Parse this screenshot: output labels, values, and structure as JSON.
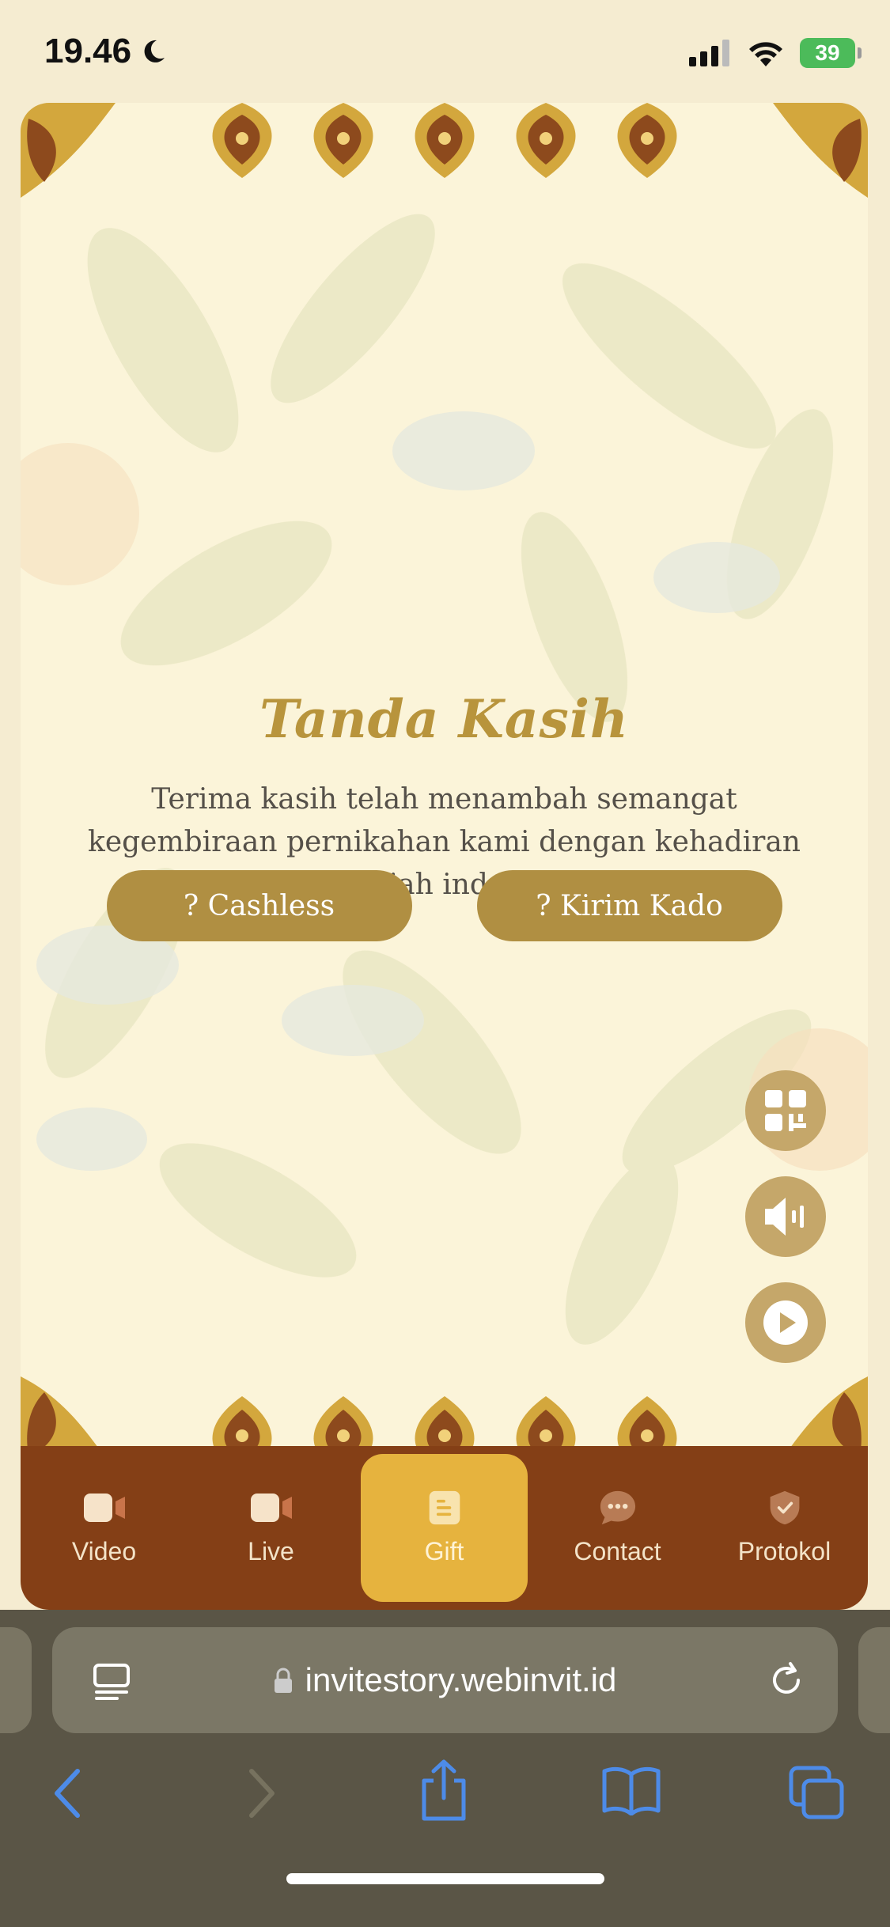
{
  "status": {
    "time": "19.46",
    "battery": "39"
  },
  "gift": {
    "title": "Tanda Kasih",
    "description": "Terima kasih telah menambah semangat kegembiraan pernikahan kami dengan kehadiran dan hadiah indah Anda.",
    "cashless_label": "? Cashless",
    "kado_label": "? Kirim Kado"
  },
  "fabs": [
    {
      "icon": "qr-code-icon"
    },
    {
      "icon": "speaker-icon"
    },
    {
      "icon": "play-icon"
    }
  ],
  "nav": {
    "items": [
      {
        "label": "Video",
        "icon": "video-icon"
      },
      {
        "label": "Live",
        "icon": "video-icon"
      },
      {
        "label": "Gift",
        "icon": "gift-document-icon",
        "active": true
      },
      {
        "label": "Contact",
        "icon": "chat-bubble-icon"
      },
      {
        "label": "Protokol",
        "icon": "shield-check-icon"
      }
    ]
  },
  "browser": {
    "url": "invitestory.webinvit.id"
  },
  "colors": {
    "gold": "#b08f42",
    "nav_bg": "#843f16",
    "nav_active": "#e6b33e",
    "title": "#b8943c"
  }
}
